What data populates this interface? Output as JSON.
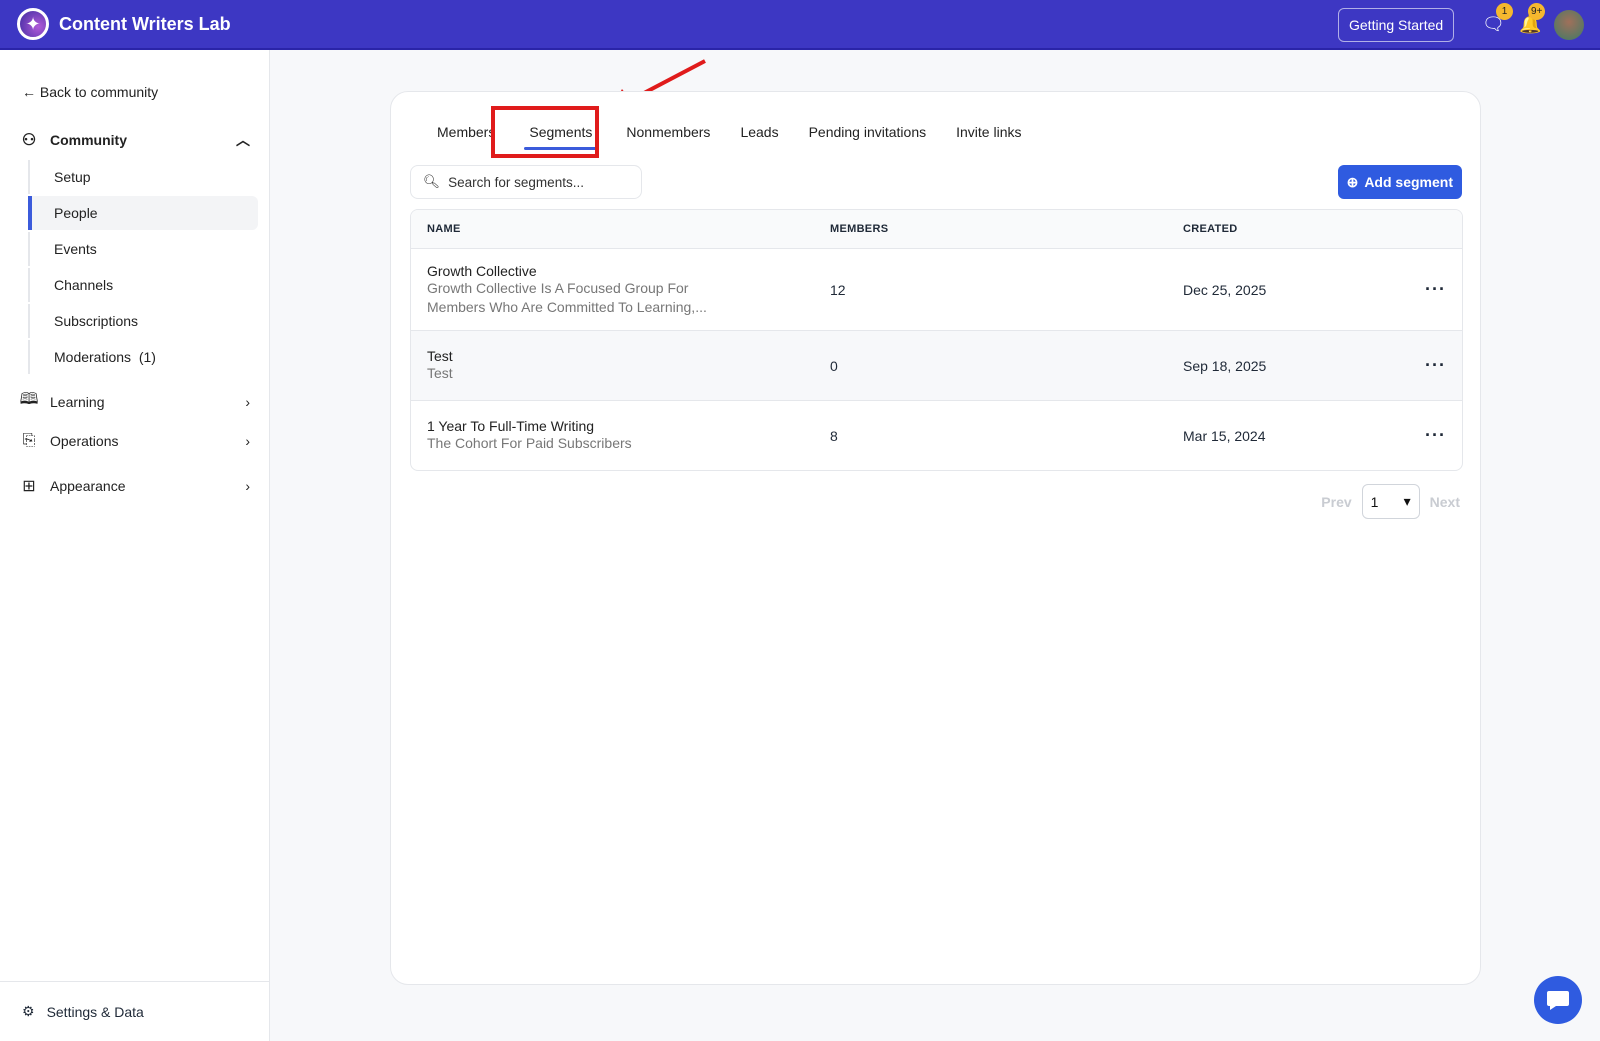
{
  "topbar": {
    "brand": "Content Writers Lab",
    "getting_started": "Getting Started",
    "chat_badge": "1",
    "notif_badge": "9+"
  },
  "sidebar": {
    "back": "Back to community",
    "community": "Community",
    "items": [
      "Setup",
      "People",
      "Events",
      "Channels",
      "Subscriptions",
      "Moderations  (1)"
    ],
    "learning": "Learning",
    "operations": "Operations",
    "appearance": "Appearance",
    "settings": "Settings & Data"
  },
  "tabs": [
    "Members",
    "Segments",
    "Nonmembers",
    "Leads",
    "Pending invitations",
    "Invite links"
  ],
  "search": {
    "placeholder": "Search for segments..."
  },
  "add_label": "Add segment",
  "table": {
    "headers": [
      "NAME",
      "MEMBERS",
      "CREATED"
    ],
    "rows": [
      {
        "name": "Growth Collective",
        "desc": "Growth Collective Is A Focused Group For Members Who Are Committed To Learning,...",
        "members": "12",
        "created": "Dec 25, 2025"
      },
      {
        "name": "Test",
        "desc": "Test",
        "members": "0",
        "created": "Sep 18, 2025"
      },
      {
        "name": "1 Year To Full-Time Writing",
        "desc": "The Cohort For Paid Subscribers",
        "members": "8",
        "created": "Mar 15, 2024"
      }
    ]
  },
  "pager": {
    "prev": "Prev",
    "page": "1",
    "next": "Next"
  }
}
